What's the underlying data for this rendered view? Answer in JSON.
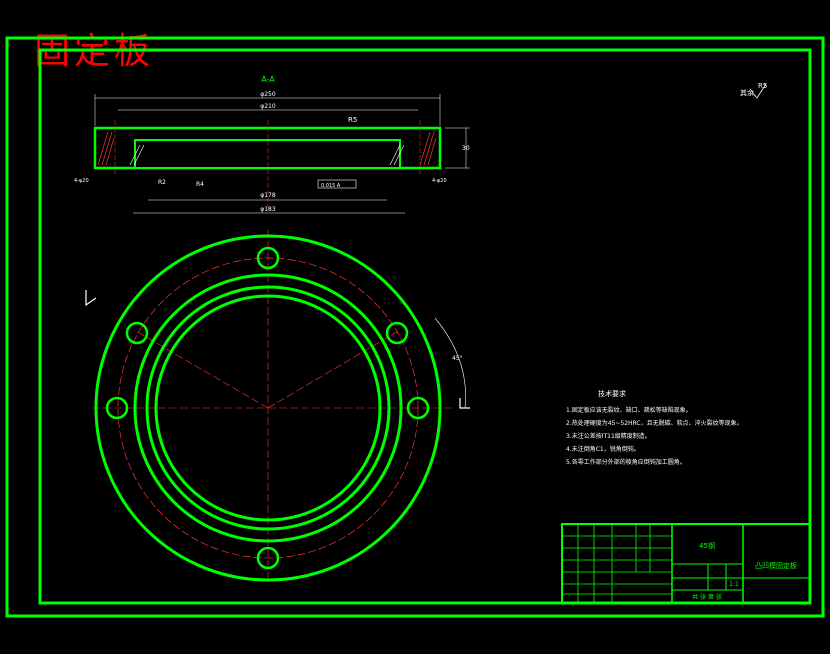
{
  "title_cn": "固定板",
  "section_label": "A-A",
  "roughness_other": "其余",
  "roughness_main": "R5",
  "tech_title": "技术要求",
  "tech_items": [
    "1.固定板应该无裂纹、缺口、疏松等缺陷现象。",
    "2.热处理硬度为45~52HRC，且无脱碳、软点、淬火裂纹等现象。",
    "3.未注公差按IT11级精度制造。",
    "4.未注倒角C1，锐角倒钝。",
    "5.各零工作部分外部的棱角应倒钝加工圆角。"
  ],
  "dims": {
    "d_outer": "φ250",
    "d_bc": "φ210",
    "d_inner": "φ178",
    "d_bottom": "φ183",
    "height": "30",
    "holes_left": "4-φ20",
    "holes_right": "4-φ20",
    "angle": "45°",
    "flatness": "0.015 A",
    "r5": "R5",
    "r4": "R4",
    "r2": "R2",
    "a_ref": "A"
  },
  "title_block": {
    "part_name": "凸凹模固定板",
    "material": "45钢",
    "scale": "1:1",
    "sheet": "共 张 第 张"
  }
}
